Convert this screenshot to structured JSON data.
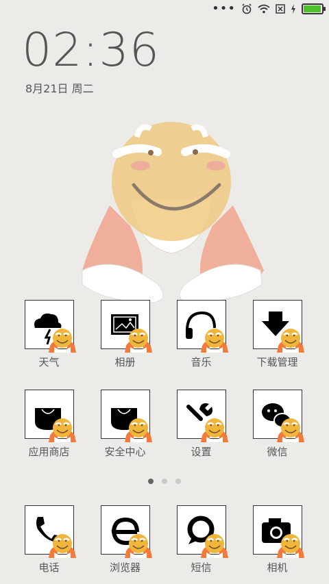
{
  "clock": {
    "time": "02:36",
    "date": "8月21日 周二"
  },
  "status": {
    "battery_level": 0.95,
    "battery_color": "#4fbf2b"
  },
  "apps_row1": [
    {
      "label": "天气",
      "icon": "weather-icon"
    },
    {
      "label": "相册",
      "icon": "gallery-icon"
    },
    {
      "label": "音乐",
      "icon": "headphones-icon"
    },
    {
      "label": "下载管理",
      "icon": "download-icon"
    }
  ],
  "apps_row2": [
    {
      "label": "应用商店",
      "icon": "app-store-icon"
    },
    {
      "label": "安全中心",
      "icon": "security-icon"
    },
    {
      "label": "设置",
      "icon": "wrench-icon"
    },
    {
      "label": "微信",
      "icon": "wechat-icon"
    }
  ],
  "dock": [
    {
      "label": "电话",
      "icon": "phone-icon"
    },
    {
      "label": "浏览器",
      "icon": "browser-icon"
    },
    {
      "label": "短信",
      "icon": "message-icon"
    },
    {
      "label": "相机",
      "icon": "camera-icon"
    }
  ],
  "pager": {
    "pages": 3,
    "current": 1
  }
}
